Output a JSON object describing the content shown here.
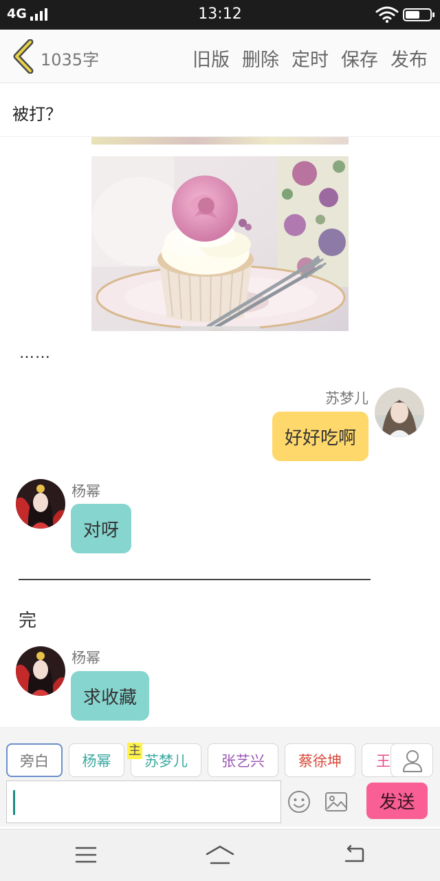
{
  "status_bar": {
    "network": "4G",
    "time": "13:12",
    "battery_level": 0.6,
    "icons": [
      "signal-icon",
      "wifi-icon",
      "battery-icon"
    ]
  },
  "toolbar": {
    "back_icon": "chevron-left-icon",
    "word_count": "1035字",
    "actions": [
      "旧版",
      "删除",
      "定时",
      "保存",
      "发布"
    ]
  },
  "article": {
    "title": "被打？",
    "ellipsis": "……",
    "end_text": "完"
  },
  "messages": [
    {
      "speaker": "苏梦儿",
      "text": "好好吃啊",
      "side": "right",
      "bubble_color": "#ffd86b"
    },
    {
      "speaker": "杨幂",
      "text": "对呀",
      "side": "left",
      "bubble_color": "#86d5cf"
    },
    {
      "speaker": "杨幂",
      "text": "求收藏",
      "side": "left",
      "bubble_color": "#86d5cf"
    }
  ],
  "roles": {
    "items": [
      {
        "label": "旁白",
        "color": "#777777",
        "active": true
      },
      {
        "label": "杨幂",
        "color": "#3aa9a0"
      },
      {
        "label": "苏梦儿",
        "color": "#3aa9a0",
        "tag": "主"
      },
      {
        "label": "张艺兴",
        "color": "#9b59b6"
      },
      {
        "label": "蔡徐坤",
        "color": "#d9483b"
      },
      {
        "label": "王",
        "color": "#e84c8b"
      }
    ],
    "user_icon": "user-icon"
  },
  "composer": {
    "input_value": "",
    "emoji_icon": "emoji-icon",
    "image_icon": "image-icon",
    "send_label": "发送",
    "send_color": "#f95f94"
  },
  "nav_bar": {
    "icons": [
      "menu-icon",
      "home-icon",
      "back-arrow-icon"
    ]
  }
}
